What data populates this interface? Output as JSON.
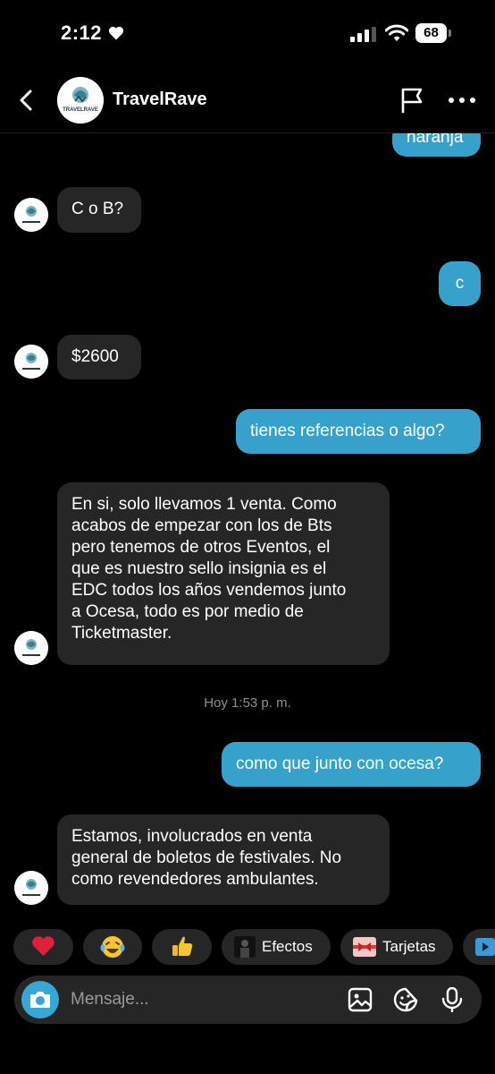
{
  "status": {
    "time": "2:12",
    "battery": "68"
  },
  "header": {
    "title": "TravelRave",
    "avatar_text": "TRAVELRAVE"
  },
  "messages": [
    {
      "side": "out",
      "text": "naranja"
    },
    {
      "side": "in",
      "text": "C o B?"
    },
    {
      "side": "out",
      "text": "c"
    },
    {
      "side": "in",
      "text": "$2600"
    },
    {
      "side": "out",
      "text": "tienes referencias o algo?"
    },
    {
      "side": "in",
      "lines": [
        "En si, solo llevamos 1 venta. Como",
        "acabos de empezar con los de Bts",
        "pero tenemos de otros Eventos, el",
        "que es nuestro sello insignia es el",
        "EDC todos los años vendemos junto",
        "a Ocesa, todo es por medio de",
        "Ticketmaster."
      ]
    },
    {
      "side": "out",
      "text": "como que junto con ocesa?"
    },
    {
      "side": "in",
      "lines": [
        "Estamos, involucrados en venta",
        "general de boletos de festivales. No",
        "como revendedores ambulantes."
      ]
    }
  ],
  "timestamp": "Hoy 1:53 p. m.",
  "chips": [
    {
      "name": "heart",
      "icon": "red-heart-emoji"
    },
    {
      "name": "laugh",
      "icon": "laughing-tears-emoji"
    },
    {
      "name": "thumbs",
      "icon": "thumbs-up-emoji"
    },
    {
      "name": "effects",
      "icon": "effects-thumbnail",
      "label": "Efectos"
    },
    {
      "name": "cards",
      "icon": "card-thumbnail",
      "label": "Tarjetas"
    }
  ],
  "composer": {
    "placeholder": "Mensaje..."
  },
  "colors": {
    "outgoing": "#36a2cc",
    "incoming": "#262626",
    "background": "#000000"
  }
}
